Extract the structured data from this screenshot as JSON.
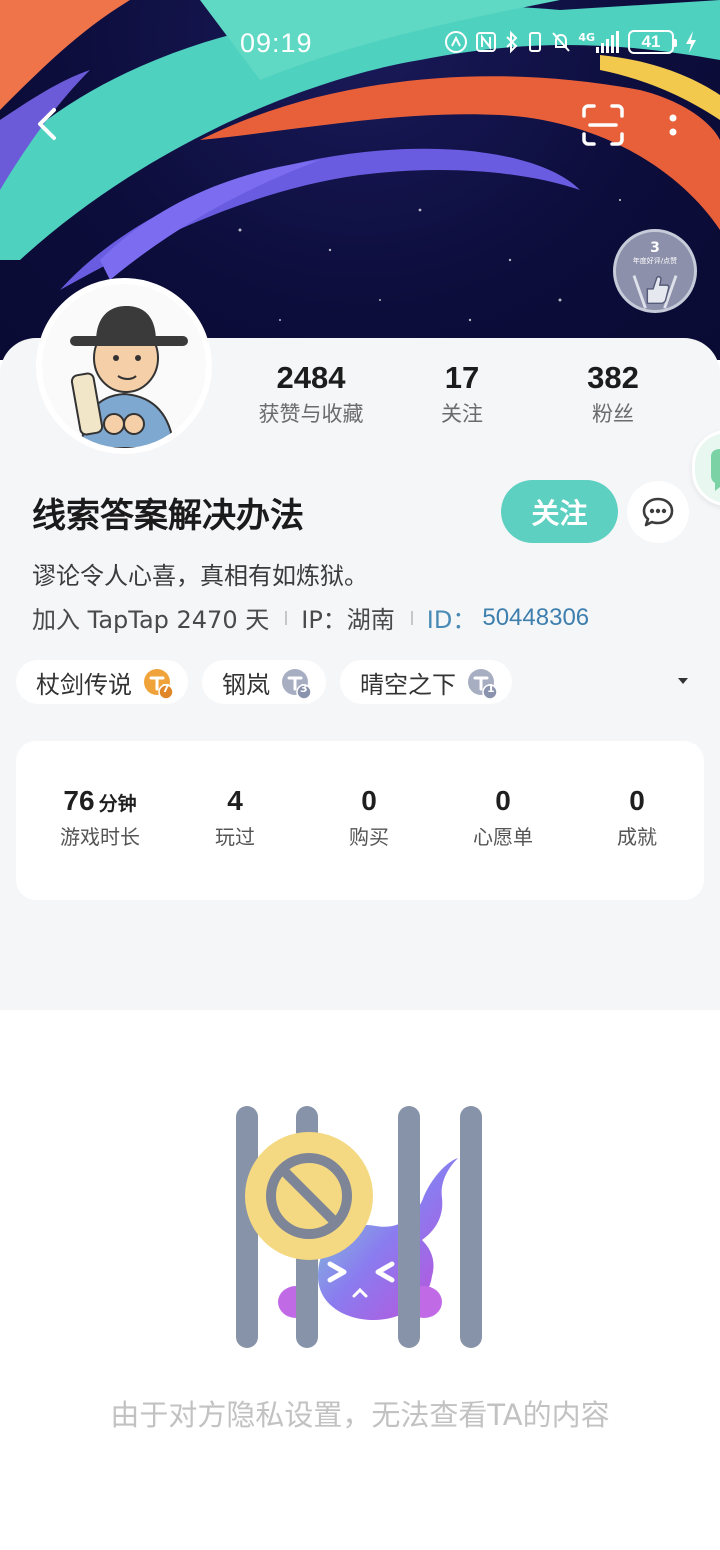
{
  "status_bar": {
    "time": "09:19",
    "network": "4G",
    "battery": "41",
    "icons": [
      "nfc-icon",
      "n-icon",
      "bluetooth-icon",
      "vibrate-icon",
      "mute-icon",
      "signal-icon",
      "charging-icon"
    ]
  },
  "nav": {
    "back_icon": "chevron-left-icon",
    "scan_icon": "scan-icon",
    "more_icon": "more-vertical-icon"
  },
  "badge": {
    "number": "3",
    "caption": "年度好评/点赞"
  },
  "stats": [
    {
      "value": "2484",
      "label": "获赞与收藏"
    },
    {
      "value": "17",
      "label": "关注"
    },
    {
      "value": "382",
      "label": "粉丝"
    }
  ],
  "profile": {
    "username": "线索答案解决办法",
    "follow_label": "关注",
    "bio": "谬论令人心喜，真相有如炼狱。",
    "join_text": "加入 TapTap 2470 天",
    "ip_text": "IP：湖南",
    "id_label": "ID：",
    "id_value": "50448306"
  },
  "tags": [
    {
      "name": "杖剑传说",
      "level": "7",
      "color": "#f0a33a"
    },
    {
      "name": "钢岚",
      "level": "3",
      "color": "#8a93ad"
    },
    {
      "name": "晴空之下",
      "level": "1",
      "color": "#8a93ad"
    }
  ],
  "game_stats": {
    "playtime": {
      "value": "76",
      "unit": "分钟",
      "label": "游戏时长"
    },
    "played": {
      "value": "4",
      "label": "玩过"
    },
    "purchased": {
      "value": "0",
      "label": "购买"
    },
    "wishlist": {
      "value": "0",
      "label": "心愿单"
    },
    "achievements": {
      "value": "0",
      "label": "成就"
    }
  },
  "empty_state": {
    "message": "由于对方隐私设置，无法查看TA的内容"
  },
  "colors": {
    "accent": "#5ed0c1",
    "id_blue": "#3e7fae",
    "card_bg": "#f5f6f8"
  }
}
